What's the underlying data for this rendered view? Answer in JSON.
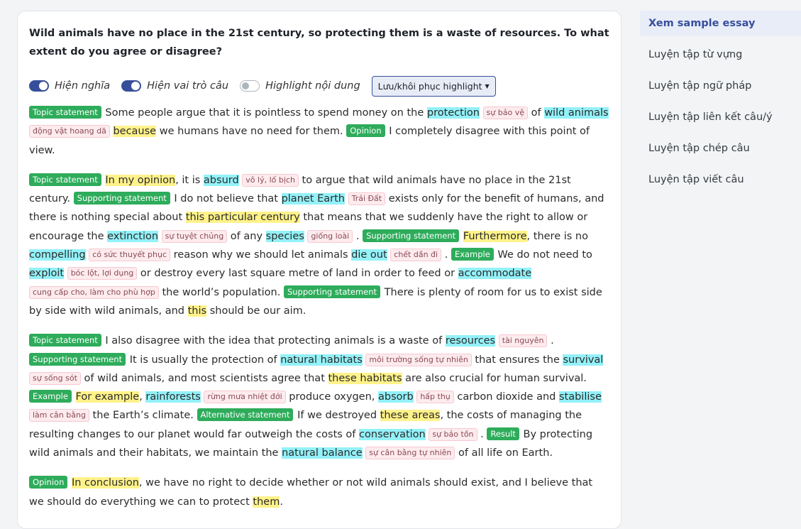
{
  "question": "Wild animals have no place in the 21st century, so protecting them is a waste of resources. To what extent do you agree or disagree?",
  "toggles": [
    {
      "label": "Hiện nghĩa",
      "state": "on"
    },
    {
      "label": "Hiện vai trò câu",
      "state": "on"
    },
    {
      "label": "Highlight nội dung",
      "state": "off"
    }
  ],
  "highlight_button": "Lưu/khôi phục highlight",
  "sidebar": {
    "items": [
      {
        "label": "Xem sample essay",
        "active": true
      },
      {
        "label": "Luyện tập từ vựng",
        "active": false
      },
      {
        "label": "Luyện tập ngữ pháp",
        "active": false
      },
      {
        "label": "Luyện tập liên kết câu/ý",
        "active": false
      },
      {
        "label": "Luyện tập chép câu",
        "active": false
      },
      {
        "label": "Luyện tập viết câu",
        "active": false
      }
    ]
  },
  "paragraphs": [
    [
      {
        "t": "badge",
        "v": "Topic statement"
      },
      {
        "t": "text",
        "v": " Some people argue that it is pointless to spend money on the "
      },
      {
        "t": "kw",
        "v": "protection"
      },
      {
        "t": "text",
        "v": " "
      },
      {
        "t": "mean",
        "v": "sự bảo vệ"
      },
      {
        "t": "text",
        "v": " of "
      },
      {
        "t": "kw",
        "v": "wild animals"
      },
      {
        "t": "text",
        "v": " "
      },
      {
        "t": "mean",
        "v": "động vật hoang dã"
      },
      {
        "t": "text",
        "v": " "
      },
      {
        "t": "link",
        "v": "because"
      },
      {
        "t": "text",
        "v": " we humans have no need for them. "
      },
      {
        "t": "badge",
        "v": "Opinion"
      },
      {
        "t": "text",
        "v": " I completely disagree with this point of view."
      }
    ],
    [
      {
        "t": "badge",
        "v": "Topic statement"
      },
      {
        "t": "text",
        "v": " "
      },
      {
        "t": "link",
        "v": "In my opinion"
      },
      {
        "t": "text",
        "v": ", it is "
      },
      {
        "t": "kw",
        "v": "absurd"
      },
      {
        "t": "text",
        "v": " "
      },
      {
        "t": "mean",
        "v": "vô lý, lố bịch"
      },
      {
        "t": "text",
        "v": " to argue that wild animals have no place in the 21st century. "
      },
      {
        "t": "badge",
        "v": "Supporting statement"
      },
      {
        "t": "text",
        "v": " I do not believe that "
      },
      {
        "t": "kw",
        "v": "planet Earth"
      },
      {
        "t": "text",
        "v": " "
      },
      {
        "t": "mean",
        "v": "Trái Đất"
      },
      {
        "t": "text",
        "v": " exists only for the benefit of humans, and there is nothing special about "
      },
      {
        "t": "link",
        "v": "this particular century"
      },
      {
        "t": "text",
        "v": " that means that we suddenly have the right to allow or encourage the "
      },
      {
        "t": "kw",
        "v": "extinction"
      },
      {
        "t": "text",
        "v": " "
      },
      {
        "t": "mean",
        "v": "sự tuyệt chủng"
      },
      {
        "t": "text",
        "v": " of any "
      },
      {
        "t": "kw",
        "v": "species"
      },
      {
        "t": "text",
        "v": " "
      },
      {
        "t": "mean",
        "v": "giống loài"
      },
      {
        "t": "text",
        "v": " . "
      },
      {
        "t": "badge",
        "v": "Supporting statement"
      },
      {
        "t": "text",
        "v": " "
      },
      {
        "t": "link",
        "v": "Furthermore"
      },
      {
        "t": "text",
        "v": ", there is no "
      },
      {
        "t": "kw",
        "v": "compelling"
      },
      {
        "t": "text",
        "v": " "
      },
      {
        "t": "mean",
        "v": "có sức thuyết phục"
      },
      {
        "t": "text",
        "v": " reason why we should let animals "
      },
      {
        "t": "kw",
        "v": "die out"
      },
      {
        "t": "text",
        "v": " "
      },
      {
        "t": "mean",
        "v": "chết dần đi"
      },
      {
        "t": "text",
        "v": " . "
      },
      {
        "t": "badge",
        "v": "Example"
      },
      {
        "t": "text",
        "v": " We do not need to "
      },
      {
        "t": "kw",
        "v": "exploit"
      },
      {
        "t": "text",
        "v": " "
      },
      {
        "t": "mean",
        "v": "bóc lột, lợi dụng"
      },
      {
        "t": "text",
        "v": " or destroy every last square metre of land in order to feed or "
      },
      {
        "t": "kw",
        "v": "accommodate"
      },
      {
        "t": "text",
        "v": " "
      },
      {
        "t": "mean",
        "v": "cung cấp cho, làm cho phù hợp"
      },
      {
        "t": "text",
        "v": " the world’s population. "
      },
      {
        "t": "badge",
        "v": "Supporting statement"
      },
      {
        "t": "text",
        "v": " There is plenty of room for us to exist side by side with wild animals, and "
      },
      {
        "t": "link",
        "v": "this"
      },
      {
        "t": "text",
        "v": " should be our aim."
      }
    ],
    [
      {
        "t": "badge",
        "v": "Topic statement"
      },
      {
        "t": "text",
        "v": " I also disagree with the idea that protecting animals is a waste of "
      },
      {
        "t": "kw",
        "v": "resources"
      },
      {
        "t": "text",
        "v": " "
      },
      {
        "t": "mean",
        "v": "tài nguyên"
      },
      {
        "t": "text",
        "v": " . "
      },
      {
        "t": "badge",
        "v": "Supporting statement"
      },
      {
        "t": "text",
        "v": " It is usually the protection of "
      },
      {
        "t": "kw",
        "v": "natural habitats"
      },
      {
        "t": "text",
        "v": " "
      },
      {
        "t": "mean",
        "v": "môi trường sống tự nhiên"
      },
      {
        "t": "text",
        "v": " that ensures the "
      },
      {
        "t": "kw",
        "v": "survival"
      },
      {
        "t": "text",
        "v": " "
      },
      {
        "t": "mean",
        "v": "sự sống sót"
      },
      {
        "t": "text",
        "v": " of wild animals, and most scientists agree that "
      },
      {
        "t": "link",
        "v": "these habitats"
      },
      {
        "t": "text",
        "v": " are also crucial for human survival. "
      },
      {
        "t": "badge",
        "v": "Example"
      },
      {
        "t": "text",
        "v": " "
      },
      {
        "t": "link",
        "v": "For example"
      },
      {
        "t": "text",
        "v": ", "
      },
      {
        "t": "kw",
        "v": "rainforests"
      },
      {
        "t": "text",
        "v": " "
      },
      {
        "t": "mean",
        "v": "rừng mưa nhiệt đới"
      },
      {
        "t": "text",
        "v": " produce oxygen, "
      },
      {
        "t": "kw",
        "v": "absorb"
      },
      {
        "t": "text",
        "v": " "
      },
      {
        "t": "mean",
        "v": "hấp thụ"
      },
      {
        "t": "text",
        "v": " carbon dioxide and "
      },
      {
        "t": "kw",
        "v": "stabilise"
      },
      {
        "t": "text",
        "v": " "
      },
      {
        "t": "mean",
        "v": "làm cân bằng"
      },
      {
        "t": "text",
        "v": " the Earth’s climate. "
      },
      {
        "t": "badge",
        "v": "Alternative statement"
      },
      {
        "t": "text",
        "v": " If we destroyed "
      },
      {
        "t": "link",
        "v": "these areas"
      },
      {
        "t": "text",
        "v": ", the costs of managing the resulting changes to our planet would far outweigh the costs of "
      },
      {
        "t": "kw",
        "v": "conservation"
      },
      {
        "t": "text",
        "v": " "
      },
      {
        "t": "mean",
        "v": "sự bảo tồn"
      },
      {
        "t": "text",
        "v": " . "
      },
      {
        "t": "badge",
        "v": "Result"
      },
      {
        "t": "text",
        "v": " By protecting wild animals and their habitats, we maintain the "
      },
      {
        "t": "kw",
        "v": "natural balance"
      },
      {
        "t": "text",
        "v": " "
      },
      {
        "t": "mean",
        "v": "sự cân bằng tự nhiên"
      },
      {
        "t": "text",
        "v": " of all life on Earth."
      }
    ],
    [
      {
        "t": "badge",
        "v": "Opinion"
      },
      {
        "t": "text",
        "v": " "
      },
      {
        "t": "link",
        "v": "In conclusion"
      },
      {
        "t": "text",
        "v": ", we have no right to decide whether or not wild animals should exist, and I believe that we should do everything we can to protect "
      },
      {
        "t": "link",
        "v": "them"
      },
      {
        "t": "text",
        "v": "."
      }
    ]
  ]
}
